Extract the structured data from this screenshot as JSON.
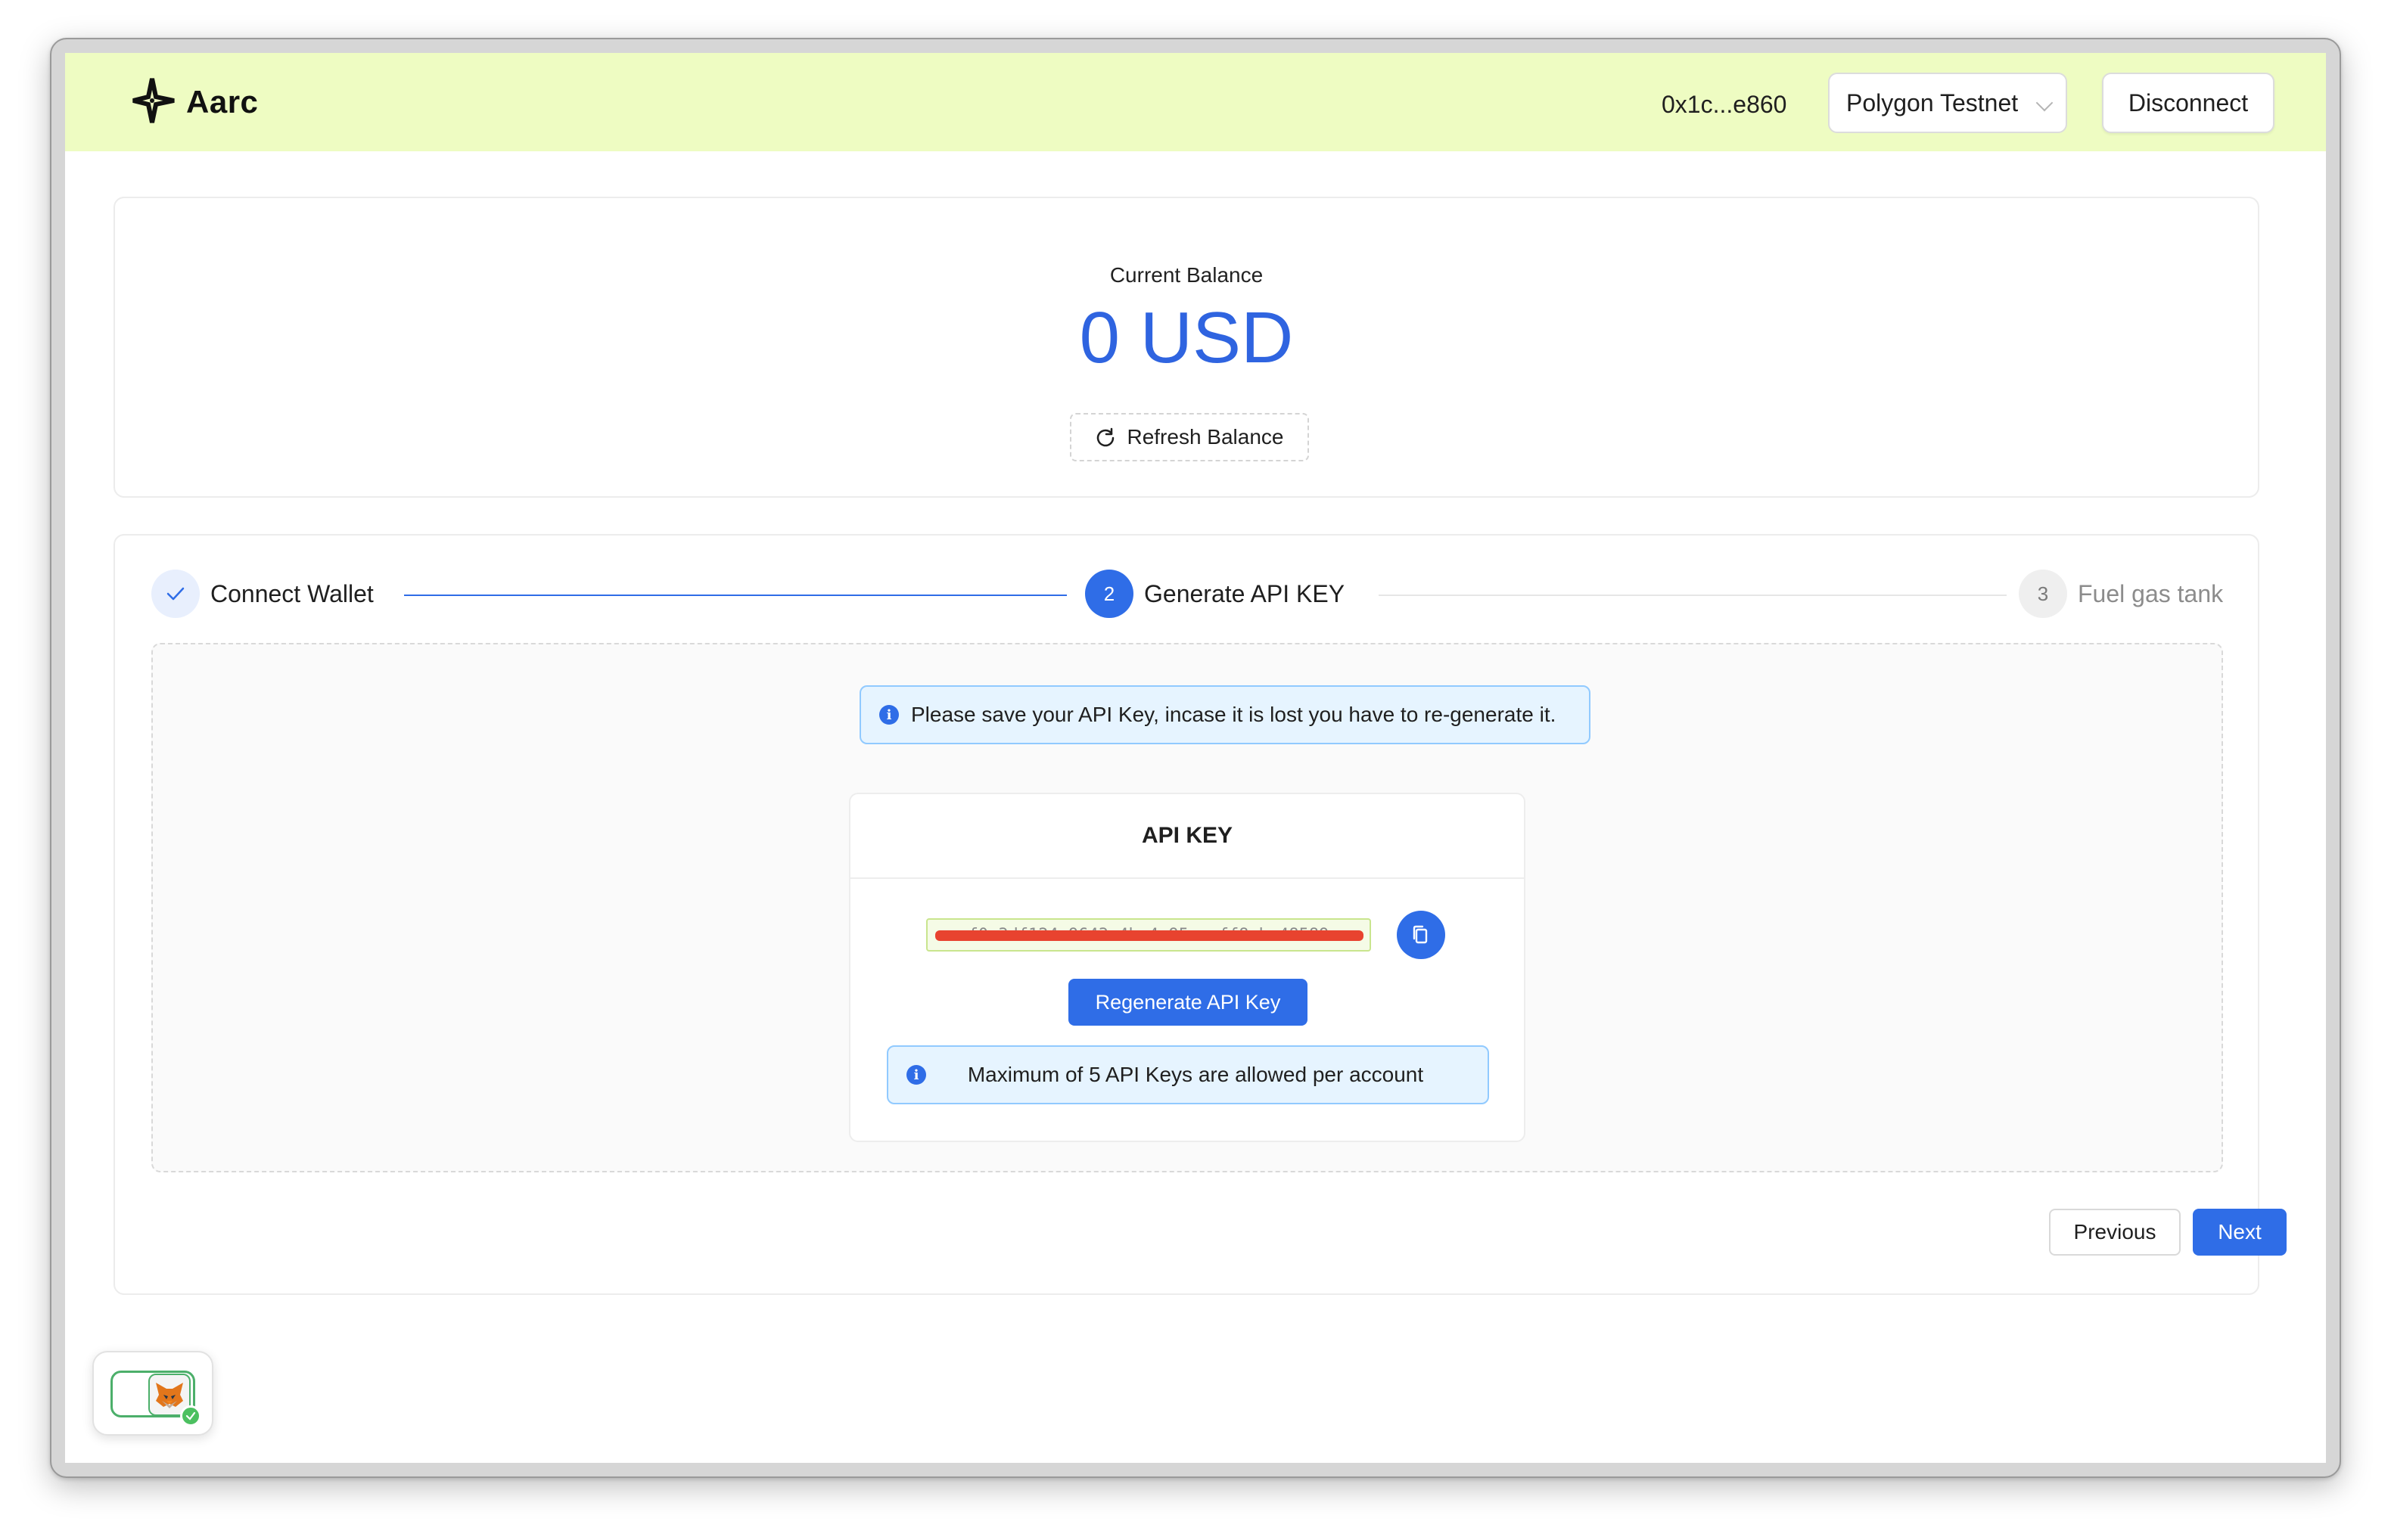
{
  "brand": {
    "name": "Aarc"
  },
  "header": {
    "wallet_address": "0x1c...e860",
    "network": "Polygon Testnet",
    "disconnect_label": "Disconnect"
  },
  "balance": {
    "label": "Current Balance",
    "value": "0 USD",
    "refresh_label": "Refresh Balance"
  },
  "steps": [
    {
      "number": "",
      "label": "Connect Wallet",
      "status": "completed"
    },
    {
      "number": "2",
      "label": "Generate API KEY",
      "status": "active"
    },
    {
      "number": "3",
      "label": "Fuel gas tank",
      "status": "pending"
    }
  ],
  "notice": "Please save your API Key, incase it is lost you have to re-generate it.",
  "api_card": {
    "title": "API KEY",
    "key_value": "f0e3df124-9643-4bc4-95cc-ff8ab-48589",
    "regenerate_label": "Regenerate API Key",
    "limit_notice": "Maximum of 5 API Keys are allowed per account"
  },
  "nav": {
    "previous_label": "Previous",
    "next_label": "Next"
  },
  "colors": {
    "accent": "#2f6de7",
    "header_bg": "#eefcc2",
    "info_bg": "#e6f4ff",
    "info_border": "#91caff"
  },
  "icons": [
    "aarc-logo-icon",
    "chevron-down-icon",
    "refresh-icon",
    "check-icon",
    "info-icon",
    "copy-icon",
    "metamask-fox-icon",
    "connected-check-icon"
  ]
}
